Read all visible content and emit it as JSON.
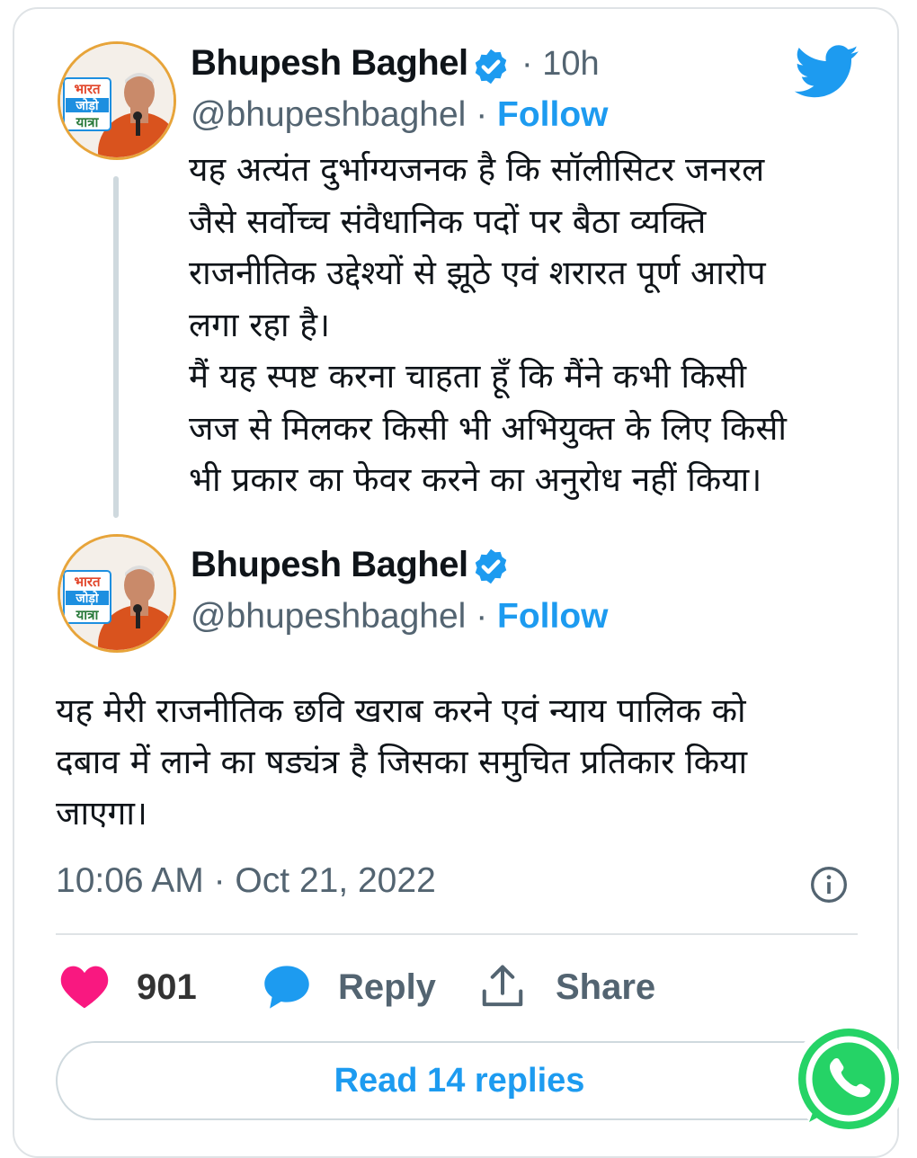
{
  "tweet1": {
    "name": "Bhupesh Baghel",
    "time": "10h",
    "handle": "@bhupeshbaghel",
    "follow_label": "Follow",
    "text_lines": [
      "यह अत्यंत दुर्भाग्यजनक है कि सॉलीसिटर जनरल",
      "जैसे सर्वोच्च संवैधानिक पदों पर बैठा व्यक्ति",
      "राजनीतिक उद्देश्यों से झूठे एवं शरारत पूर्ण आरोप",
      "लगा रहा है।",
      "मैं यह स्पष्ट करना चाहता हूँ कि मैंने कभी किसी",
      "जज से मिलकर किसी भी अभियुक्त के लिए किसी",
      "भी प्रकार का फेवर करने का अनुरोध नहीं किया।"
    ]
  },
  "tweet2": {
    "name": "Bhupesh Baghel",
    "handle": "@bhupeshbaghel",
    "follow_label": "Follow",
    "text_lines": [
      "यह मेरी राजनीतिक छवि खराब करने एवं न्याय पालिक को",
      "दबाव में लाने का षड्यंत्र है जिसका समुचित प्रतिकार किया",
      "जाएगा।"
    ],
    "timestamp": "10:06 AM · Oct 21, 2022"
  },
  "avatar_badge_lines": [
    "भारत",
    "जोड़ो",
    "यात्रा"
  ],
  "actions": {
    "likes": "901",
    "reply_label": "Reply",
    "share_label": "Share"
  },
  "read_replies_label": "Read 14 replies",
  "colors": {
    "accent": "#1d9bf0",
    "heart": "#f91880",
    "muted_text": "#536471",
    "whatsapp": "#25d366"
  },
  "icons": [
    "twitter-bird-icon",
    "verified-badge-icon",
    "info-icon",
    "heart-icon",
    "reply-bubble-icon",
    "share-icon",
    "whatsapp-icon"
  ]
}
